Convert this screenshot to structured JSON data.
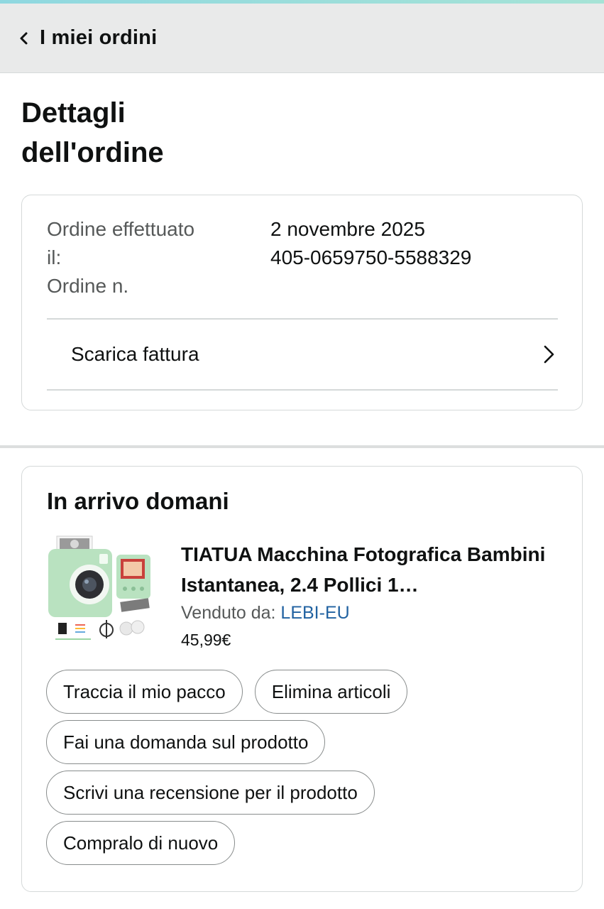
{
  "nav": {
    "back_label": "I miei ordini",
    "back_icon": "chevron-left-icon"
  },
  "page_title_line1": "Dettagli",
  "page_title_line2": "dell'ordine",
  "order_info": {
    "placed_label_line1": "Ordine effettuato",
    "placed_label_line2": "il:",
    "number_label": "Ordine n.",
    "placed_value": "2 novembre 2025",
    "number_value": "405-0659750-5588329",
    "invoice_label": "Scarica fattura",
    "invoice_icon": "chevron-right-icon"
  },
  "shipment": {
    "status_title": "In arrivo domani",
    "product": {
      "title": "TIATUA Macchina Fotografica Bambini Istantanea, 2.4 Pollici 1…",
      "seller_label": "Venduto da:",
      "seller_name": "LEBI-EU",
      "price": "45,99€",
      "image_icon": "instant-camera-product-image"
    },
    "actions": [
      "Traccia il mio pacco",
      "Elimina articoli",
      "Fai una domanda sul prodotto",
      "Scrivi una recensione per il prodotto",
      "Compralo di nuovo"
    ]
  },
  "colors": {
    "link": "#2162a1",
    "muted_text": "#565959",
    "nav_background": "#e9eaea",
    "camera_body": "#b9e2c0"
  }
}
